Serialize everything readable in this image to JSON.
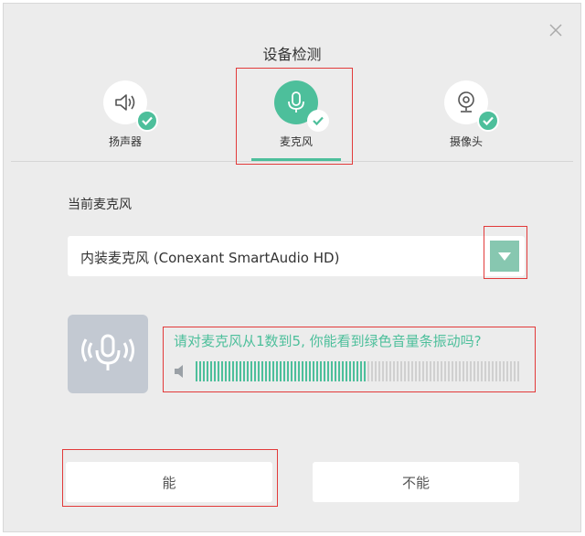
{
  "dialog": {
    "title": "设备检测",
    "close_icon": "close-icon"
  },
  "tabs": [
    {
      "label": "扬声器",
      "icon": "speaker-icon",
      "status": "check-icon"
    },
    {
      "label": "麦克风",
      "icon": "microphone-icon",
      "status": "check-icon",
      "active": true
    },
    {
      "label": "摄像头",
      "icon": "camera-icon",
      "status": "check-icon"
    }
  ],
  "microphone": {
    "section_label": "当前麦克风",
    "selected_device": "内装麦克风 (Conexant SmartAudio HD)",
    "dropdown_icon": "triangle-down-icon",
    "tile_icon": "mic-broadcast-icon",
    "prompt": "请对麦克风从1数到5, 你能看到绿色音量条振动吗?",
    "volume_level": 0.53
  },
  "actions": {
    "yes_label": "能",
    "no_label": "不能"
  },
  "colors": {
    "accent": "#4dbf9b",
    "dropdown": "#87c7b0",
    "highlight": "#e23a3a"
  }
}
